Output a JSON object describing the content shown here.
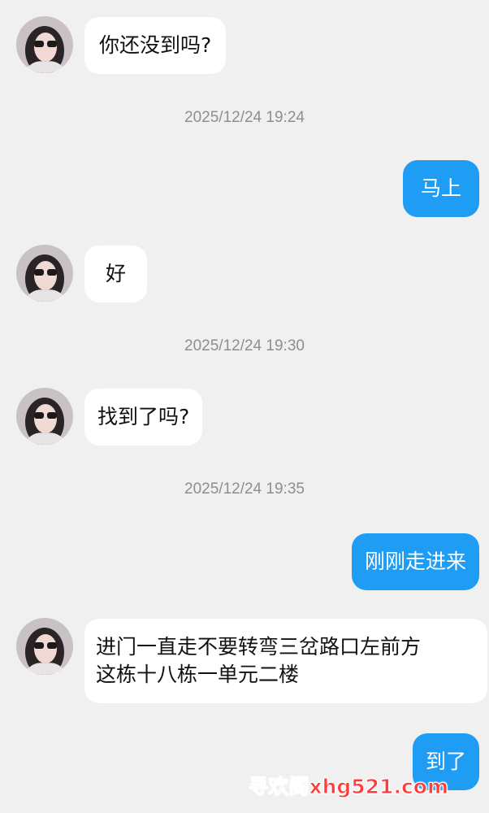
{
  "messages": [
    {
      "type": "in",
      "text": "你还没到吗?"
    },
    {
      "type": "time",
      "text": "2025/12/24 19:24"
    },
    {
      "type": "out",
      "text": "马上"
    },
    {
      "type": "in",
      "text": "好"
    },
    {
      "type": "time",
      "text": "2025/12/24 19:30"
    },
    {
      "type": "in",
      "text": "找到了吗?"
    },
    {
      "type": "time",
      "text": "2025/12/24 19:35"
    },
    {
      "type": "out",
      "text": "刚刚走进来"
    },
    {
      "type": "in",
      "lines": [
        "进门一直走不要转弯三岔路口左前方",
        "这栋十八栋一单元二楼"
      ]
    },
    {
      "type": "out",
      "text": "到了"
    }
  ],
  "watermark": "寻欢阁xhg521.com",
  "colors": {
    "background": "#f0f0f0",
    "incoming_bubble": "#ffffff",
    "outgoing_bubble": "#1f9df5",
    "timestamp": "#8e8e8e",
    "watermark": "#ff3b3b"
  },
  "icons": {
    "avatar": "contact-avatar-icon"
  }
}
